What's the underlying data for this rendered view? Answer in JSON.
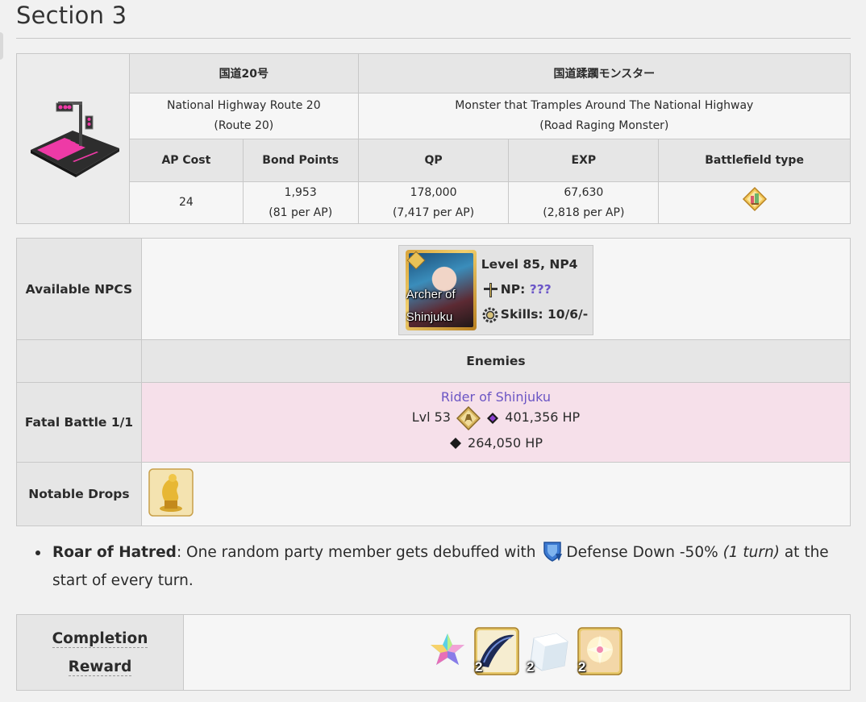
{
  "section": {
    "title": "Section 3"
  },
  "quest": {
    "jp_location": "国道20号",
    "jp_name": "国道蹂躙モンスター",
    "en_location": "National Highway Route 20",
    "en_location_short": "(Route 20)",
    "en_name": "Monster that Tramples Around The National Highway",
    "en_name_short": "(Road Raging Monster)",
    "headers": [
      "AP Cost",
      "Bond Points",
      "QP",
      "EXP",
      "Battlefield type"
    ],
    "ap_cost": "24",
    "bond_points": "1,953",
    "bond_per_ap": "(81 per AP)",
    "qp": "178,000",
    "qp_per_ap": "(7,417 per AP)",
    "exp": "67,630",
    "exp_per_ap": "(2,818 per AP)",
    "battlefield_icon": "city-battlefield-icon"
  },
  "npcs": {
    "label": "Available NPCS",
    "name": "Archer of Shinjuku",
    "name_line1": "Archer of",
    "name_line2": "Shinjuku",
    "level": "Level 85, NP4",
    "np_label": "NP:",
    "np_value": "???",
    "skills": "Skills: 10/6/-"
  },
  "enemies": {
    "header": "Enemies",
    "battle_label": "Fatal Battle 1/1",
    "name": "Rider of Shinjuku",
    "level": "Lvl 53",
    "hp1": "401,356 HP",
    "hp2": "264,050 HP"
  },
  "drops": {
    "label": "Notable Drops",
    "item_icon": "gold-statue-icon"
  },
  "notes": {
    "title": "Roar of Hatred",
    "text_a": ": One random party member gets debuffed with ",
    "effect": "Defense Down -50%",
    "turn": "(1 turn)",
    "text_b": " at the start of every turn."
  },
  "completion": {
    "label_line1": "Completion",
    "label_line2": "Reward",
    "rewards": [
      {
        "icon": "saint-quartz-icon",
        "count": ""
      },
      {
        "icon": "claw-material-icon",
        "count": "2"
      },
      {
        "icon": "crystal-material-icon",
        "count": "2"
      },
      {
        "icon": "golden-material-icon",
        "count": "2"
      }
    ]
  },
  "colors": {
    "accent_link": "#6b55c4",
    "fatal_bg": "#f6e0ea",
    "header_bg": "#e6e6e6"
  }
}
